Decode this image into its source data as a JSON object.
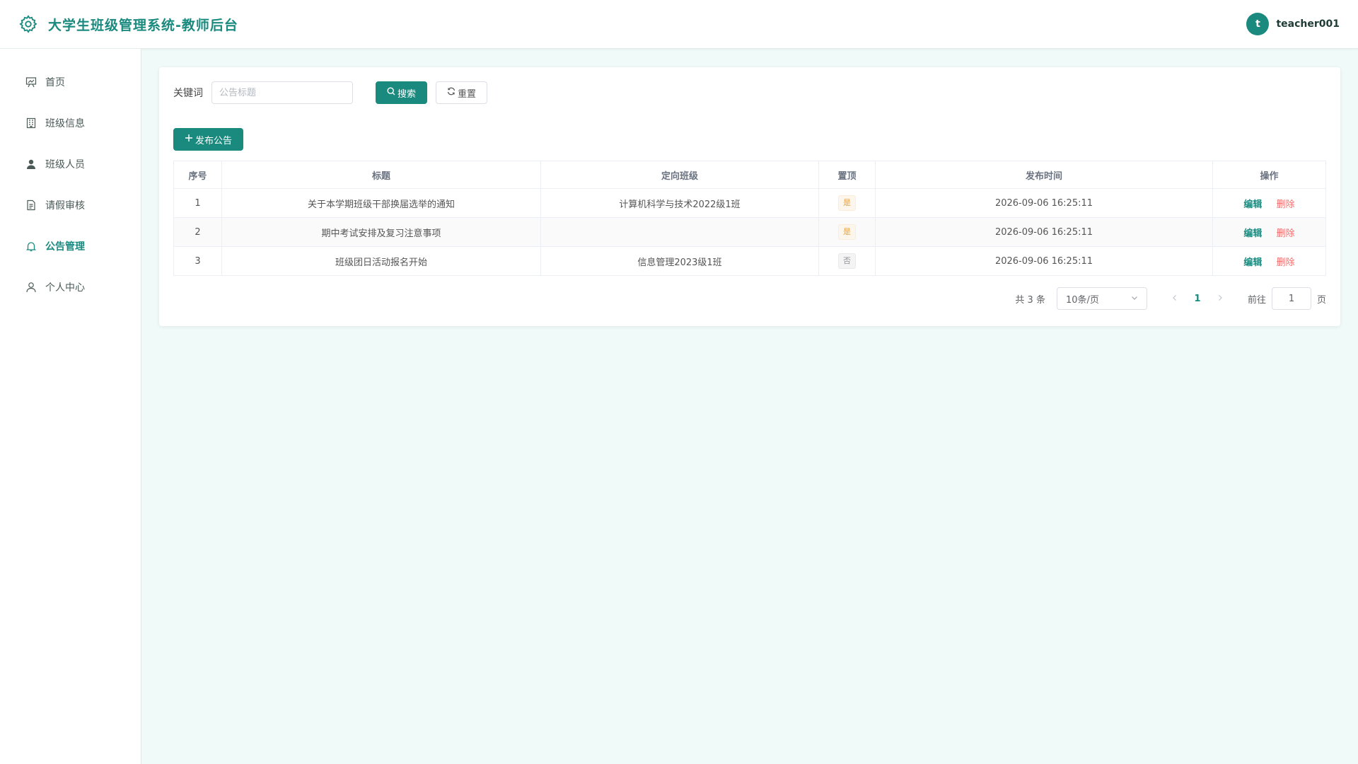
{
  "header": {
    "title": "大学生班级管理系统-教师后台",
    "avatar_letter": "t",
    "username": "teacher001",
    "accent": "#1a8a7f"
  },
  "sidebar": {
    "items": [
      {
        "label": "首页",
        "icon": "presentation-icon"
      },
      {
        "label": "班级信息",
        "icon": "building-icon"
      },
      {
        "label": "班级人员",
        "icon": "user-icon"
      },
      {
        "label": "请假审核",
        "icon": "document-icon"
      },
      {
        "label": "公告管理",
        "icon": "bell-icon",
        "active": true
      },
      {
        "label": "个人中心",
        "icon": "person-icon"
      }
    ]
  },
  "search": {
    "label": "关键词",
    "placeholder": "公告标题",
    "value": "",
    "search_button": "搜索",
    "reset_button": "重置"
  },
  "actions": {
    "add_button": "发布公告"
  },
  "table": {
    "columns": [
      "序号",
      "标题",
      "定向班级",
      "置顶",
      "发布时间",
      "操作"
    ],
    "rows": [
      {
        "index": "1",
        "title": "关于本学期班级干部换届选举的通知",
        "class": "计算机科学与技术2022级1班",
        "pinned": "是",
        "pinned_bool": true,
        "time": "2026-09-06 16:25:11",
        "edit": "编辑",
        "delete": "删除"
      },
      {
        "index": "2",
        "title": "期中考试安排及复习注意事项",
        "class": "",
        "pinned": "是",
        "pinned_bool": true,
        "time": "2026-09-06 16:25:11",
        "edit": "编辑",
        "delete": "删除"
      },
      {
        "index": "3",
        "title": "班级团日活动报名开始",
        "class": "信息管理2023级1班",
        "pinned": "否",
        "pinned_bool": false,
        "time": "2026-09-06 16:25:11",
        "edit": "编辑",
        "delete": "删除"
      }
    ]
  },
  "pagination": {
    "total_text": "共 3 条",
    "page_size": "10条/页",
    "current_page": "1",
    "jump_label": "前往",
    "jump_value": "1",
    "jump_suffix": "页"
  }
}
